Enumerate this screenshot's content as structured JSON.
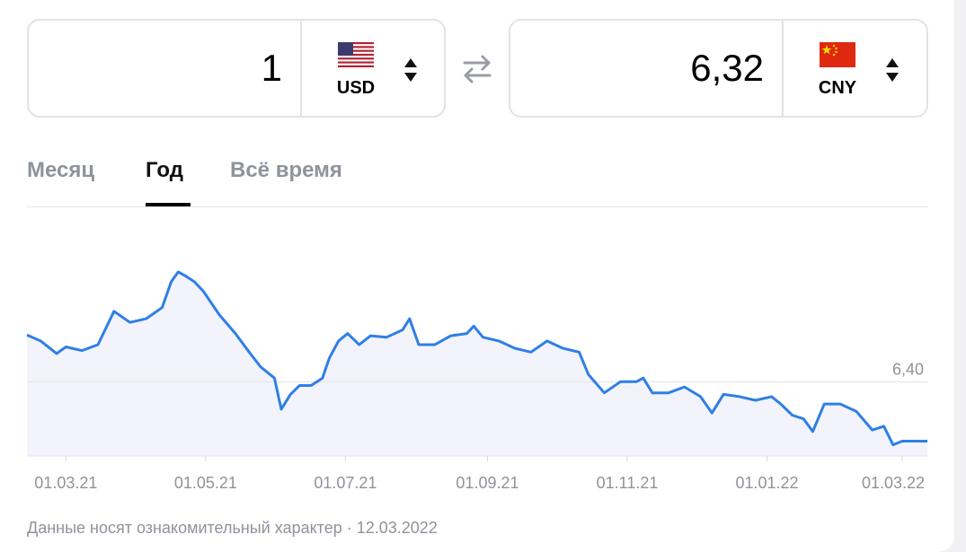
{
  "converter": {
    "from": {
      "amount": "1",
      "currency": "USD",
      "flag": "us-flag-icon"
    },
    "to": {
      "amount": "6,32",
      "currency": "CNY",
      "flag": "cn-flag-icon"
    }
  },
  "tabs": [
    {
      "label": "Месяц",
      "active": false
    },
    {
      "label": "Год",
      "active": true
    },
    {
      "label": "Всё время",
      "active": false
    }
  ],
  "footnote": "Данные носят ознакомительный характер · 12.03.2022",
  "colors": {
    "line": "#2f7fe6",
    "area": "#f3f4fb",
    "muted": "#8f939b"
  },
  "chart_data": {
    "type": "line",
    "reference": {
      "value": 6.4,
      "label": "6,40"
    },
    "x_tick_labels": [
      "01.03.21",
      "01.05.21",
      "01.07.21",
      "01.09.21",
      "01.11.21",
      "01.01.22",
      "01.03.22"
    ],
    "x_range": [
      "2021-02-12",
      "2022-03-12"
    ],
    "ylim": [
      6.3,
      6.6
    ],
    "series": [
      {
        "points": [
          [
            "2021-02-12",
            6.463
          ],
          [
            "2021-02-18",
            6.455
          ],
          [
            "2021-02-25",
            6.438
          ],
          [
            "2021-03-01",
            6.447
          ],
          [
            "2021-03-08",
            6.442
          ],
          [
            "2021-03-15",
            6.45
          ],
          [
            "2021-03-22",
            6.495
          ],
          [
            "2021-03-29",
            6.48
          ],
          [
            "2021-04-05",
            6.485
          ],
          [
            "2021-04-12",
            6.5
          ],
          [
            "2021-04-16",
            6.535
          ],
          [
            "2021-04-19",
            6.548
          ],
          [
            "2021-04-22",
            6.543
          ],
          [
            "2021-04-26",
            6.535
          ],
          [
            "2021-04-30",
            6.522
          ],
          [
            "2021-05-07",
            6.49
          ],
          [
            "2021-05-14",
            6.465
          ],
          [
            "2021-05-20",
            6.44
          ],
          [
            "2021-05-25",
            6.42
          ],
          [
            "2021-05-31",
            6.405
          ],
          [
            "2021-06-03",
            6.363
          ],
          [
            "2021-06-07",
            6.383
          ],
          [
            "2021-06-11",
            6.395
          ],
          [
            "2021-06-16",
            6.395
          ],
          [
            "2021-06-21",
            6.405
          ],
          [
            "2021-06-24",
            6.432
          ],
          [
            "2021-06-28",
            6.455
          ],
          [
            "2021-07-02",
            6.465
          ],
          [
            "2021-07-07",
            6.45
          ],
          [
            "2021-07-12",
            6.462
          ],
          [
            "2021-07-19",
            6.46
          ],
          [
            "2021-07-26",
            6.47
          ],
          [
            "2021-07-29",
            6.485
          ],
          [
            "2021-08-02",
            6.45
          ],
          [
            "2021-08-09",
            6.45
          ],
          [
            "2021-08-16",
            6.462
          ],
          [
            "2021-08-23",
            6.465
          ],
          [
            "2021-08-26",
            6.475
          ],
          [
            "2021-08-30",
            6.46
          ],
          [
            "2021-09-06",
            6.455
          ],
          [
            "2021-09-13",
            6.445
          ],
          [
            "2021-09-20",
            6.44
          ],
          [
            "2021-09-27",
            6.455
          ],
          [
            "2021-10-04",
            6.445
          ],
          [
            "2021-10-11",
            6.44
          ],
          [
            "2021-10-15",
            6.41
          ],
          [
            "2021-10-22",
            6.385
          ],
          [
            "2021-10-29",
            6.4
          ],
          [
            "2021-11-05",
            6.4
          ],
          [
            "2021-11-08",
            6.405
          ],
          [
            "2021-11-12",
            6.385
          ],
          [
            "2021-11-19",
            6.385
          ],
          [
            "2021-11-26",
            6.393
          ],
          [
            "2021-12-03",
            6.38
          ],
          [
            "2021-12-08",
            6.358
          ],
          [
            "2021-12-13",
            6.383
          ],
          [
            "2021-12-20",
            6.38
          ],
          [
            "2021-12-27",
            6.375
          ],
          [
            "2022-01-03",
            6.38
          ],
          [
            "2022-01-07",
            6.37
          ],
          [
            "2022-01-12",
            6.355
          ],
          [
            "2022-01-17",
            6.35
          ],
          [
            "2022-01-21",
            6.333
          ],
          [
            "2022-01-26",
            6.37
          ],
          [
            "2022-02-02",
            6.37
          ],
          [
            "2022-02-09",
            6.36
          ],
          [
            "2022-02-16",
            6.335
          ],
          [
            "2022-02-21",
            6.34
          ],
          [
            "2022-02-25",
            6.315
          ],
          [
            "2022-03-01",
            6.32
          ],
          [
            "2022-03-05",
            6.32
          ],
          [
            "2022-03-12",
            6.32
          ]
        ]
      }
    ]
  }
}
